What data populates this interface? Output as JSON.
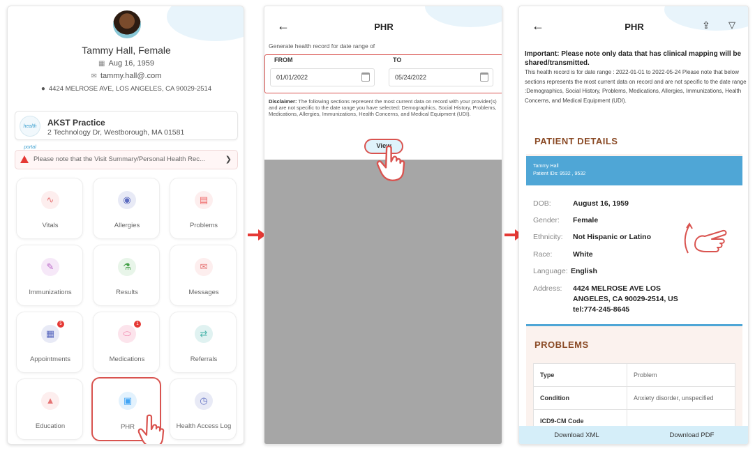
{
  "dashboard": {
    "patient_name": "Tammy Hall, Female",
    "dob": "Aug 16, 1959",
    "email": "tammy.hall@.com",
    "address": "4424 MELROSE AVE, LOS ANGELES, CA 90029-2514",
    "practice": {
      "logo_text": "health portal",
      "name": "AKST Practice",
      "address": "2 Technology Dr, Westborough, MA 01581"
    },
    "notice": "Please note that the Visit Summary/Personal Health Rec...",
    "tiles": [
      {
        "label": "Vitals",
        "icon": "heartbeat-icon",
        "color": "#e57373"
      },
      {
        "label": "Allergies",
        "icon": "allergies-icon",
        "color": "#5c6bc0"
      },
      {
        "label": "Problems",
        "icon": "clipboard-icon",
        "color": "#ef6c6c"
      },
      {
        "label": "Immunizations",
        "icon": "syringe-icon",
        "color": "#ba68c8"
      },
      {
        "label": "Results",
        "icon": "flask-icon",
        "color": "#43a047"
      },
      {
        "label": "Messages",
        "icon": "envelope-icon",
        "color": "#e57373"
      },
      {
        "label": "Appointments",
        "icon": "calendar-icon",
        "color": "#5c6bc0",
        "badge": "5"
      },
      {
        "label": "Medications",
        "icon": "pill-icon",
        "color": "#ef6c9c",
        "badge": "1"
      },
      {
        "label": "Referrals",
        "icon": "referrals-icon",
        "color": "#4db6ac"
      },
      {
        "label": "Education",
        "icon": "graduation-cap-icon",
        "color": "#e57373"
      },
      {
        "label": "PHR",
        "icon": "phr-record-icon",
        "color": "#42a5f5"
      },
      {
        "label": "Health Access Log",
        "icon": "access-log-icon",
        "color": "#5c6bc0"
      }
    ]
  },
  "phr_form": {
    "title": "PHR",
    "generate_label": "Generate health record for date range of",
    "from_label": "FROM",
    "from_value": "01/01/2022",
    "to_label": "TO",
    "to_value": "05/24/2022",
    "disclaimer_label": "Disclaimer:",
    "disclaimer_text": "The following sections represent the most current data on record with your provider(s) and are not specific to the date range you have selected: Demographics, Social History, Problems, Medications, Allergies, Immunizations, Health Concerns, and Medical Equipment (UDI).",
    "view_button": "View"
  },
  "phr_view": {
    "title": "PHR",
    "important": "Important: Please note only data that has clinical mapping will be shared/transmitted.",
    "record_text": "This health record is for date range : 2022-01-01 to 2022-05-24 Please note that below sections represents the most current data on record and are not specific to the date range :Demographics, Social History, Problems, Medications, Allergies, Immunizations, Health Concerns, and Medical Equipment (UDI).",
    "patient_details_title": "PATIENT DETAILS",
    "banner_name": "Tammy Hall",
    "banner_ids": "Patient IDs: 9532 , 9532",
    "details": [
      {
        "label": "DOB:",
        "value": "August 16, 1959"
      },
      {
        "label": "Gender:",
        "value": "Female"
      },
      {
        "label": "Ethnicity:",
        "value": "Not Hispanic or Latino"
      },
      {
        "label": "Race:",
        "value": "White"
      },
      {
        "label": "Language:",
        "value": "English"
      }
    ],
    "address_label": "Address:",
    "address_line1": "4424 MELROSE AVE    LOS",
    "address_line2": "ANGELES, CA 90029-2514, US",
    "address_line3": "tel:774-245-8645",
    "problems_title": "PROBLEMS",
    "problems": [
      {
        "key": "Type",
        "value": "Problem"
      },
      {
        "key": "Condition",
        "value": "Anxiety disorder, unspecified"
      },
      {
        "key": "ICD9-CM Code",
        "value": ""
      }
    ],
    "download_xml": "Download XML",
    "download_pdf": "Download PDF"
  },
  "colors": {
    "accent_red": "#d9534f",
    "banner_blue": "#4fa6d6",
    "section_brown": "#8a4a25",
    "overlay_gray": "#a6a6a6"
  }
}
